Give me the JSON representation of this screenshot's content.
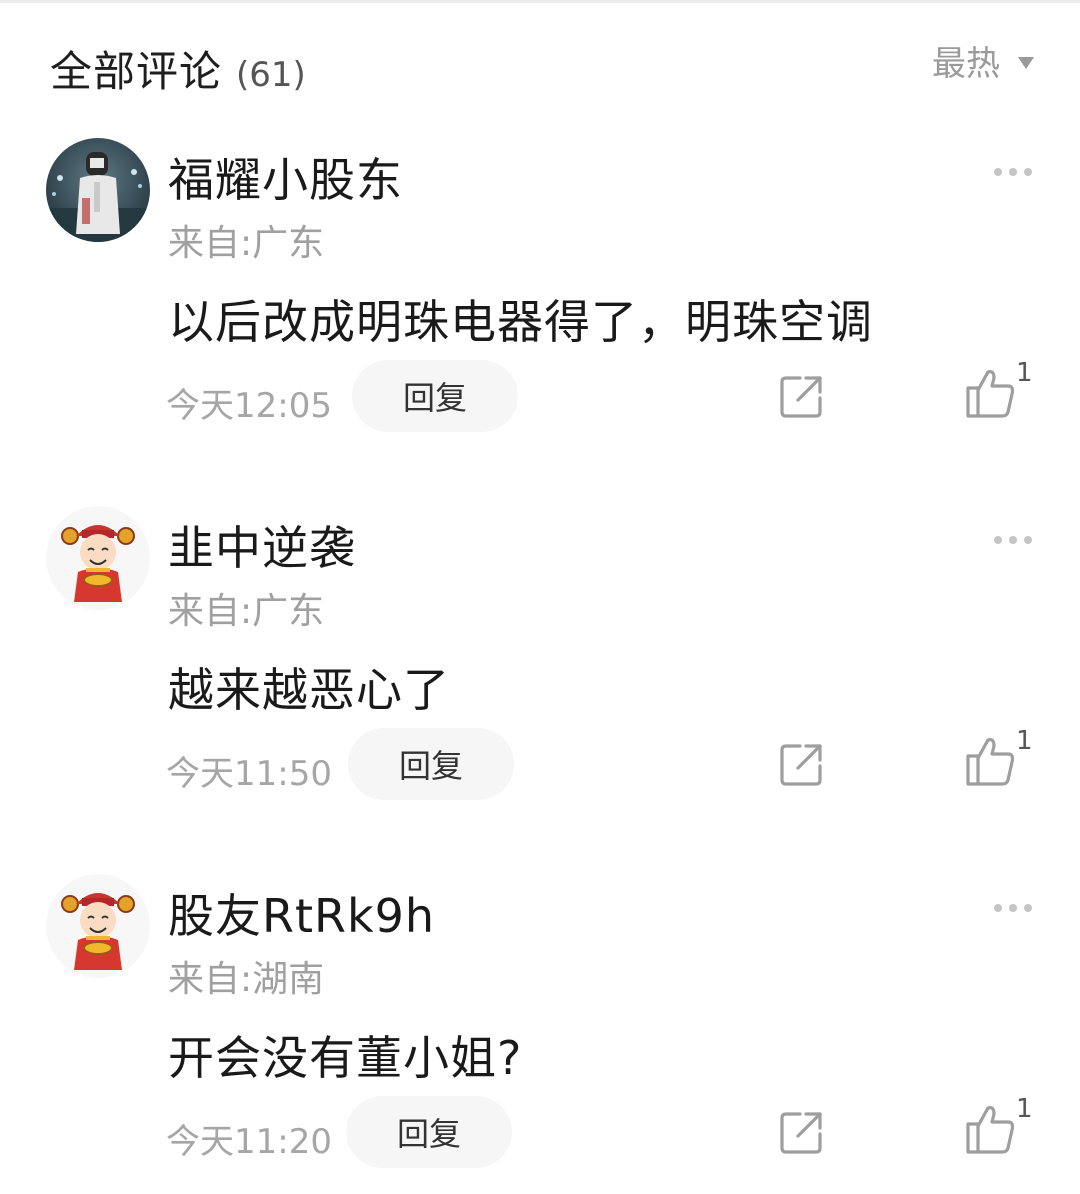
{
  "header": {
    "title": "全部评论",
    "count": "(61)",
    "sort_label": "最热"
  },
  "comments": [
    {
      "name": "福耀小股东",
      "location": "来自:广东",
      "content": "以后改成明珠电器得了，明珠空调",
      "time": "今天12:05",
      "reply_label": "回复",
      "likes": "1",
      "avatar": "photo-avatar"
    },
    {
      "name": "韭中逆袭",
      "location": "来自:广东",
      "content": "越来越恶心了",
      "time": "今天11:50",
      "reply_label": "回复",
      "likes": "1",
      "avatar": "cartoon-god-of-wealth-avatar"
    },
    {
      "name": "股友RtRk9h",
      "location": "来自:湖南",
      "content": "开会没有董小姐?",
      "time": "今天11:20",
      "reply_label": "回复",
      "likes": "1",
      "avatar": "cartoon-god-of-wealth-avatar"
    }
  ],
  "colors": {
    "primary_text": "#1a1a1a",
    "secondary_text": "#a0a0a0",
    "reply_bg": "#f6f6f6",
    "icon": "#9e9e9e"
  }
}
